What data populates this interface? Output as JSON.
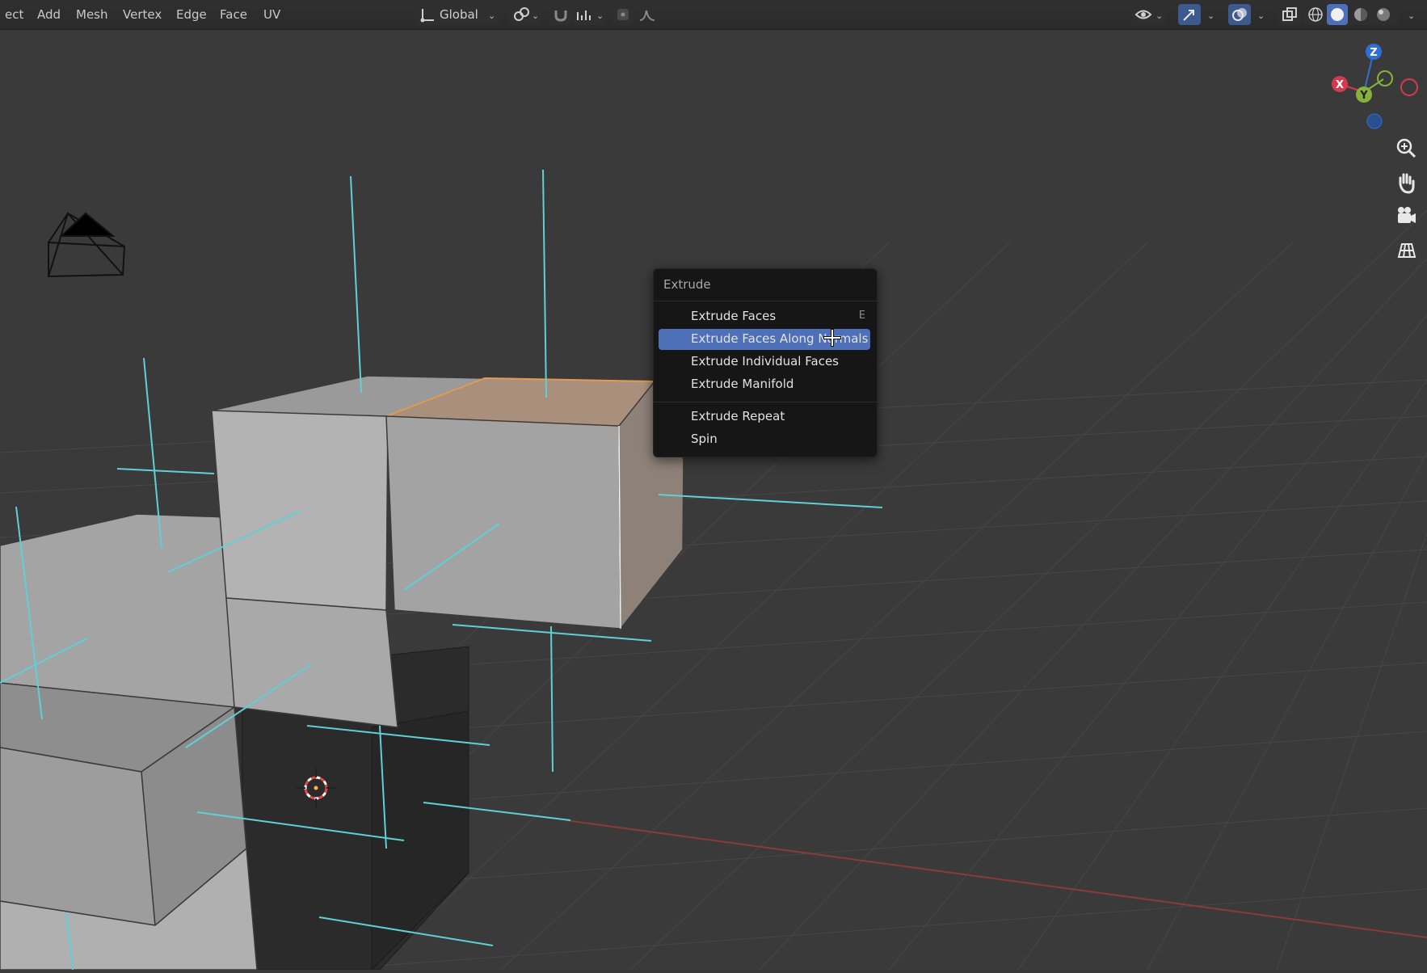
{
  "header": {
    "menus": [
      "ect",
      "Add",
      "Mesh",
      "Vertex",
      "Edge",
      "Face",
      "UV"
    ],
    "orientation": "Global"
  },
  "extrude_menu": {
    "title": "Extrude",
    "items": [
      {
        "label": "Extrude Faces",
        "shortcut": "E"
      },
      {
        "label": "Extrude Faces Along Normals",
        "shortcut": ""
      },
      {
        "label": "Extrude Individual Faces",
        "shortcut": ""
      },
      {
        "label": "Extrude Manifold",
        "shortcut": ""
      },
      {
        "label": "Extrude Repeat",
        "shortcut": ""
      },
      {
        "label": "Spin",
        "shortcut": ""
      }
    ],
    "highlighted_index": 1
  },
  "gizmo": {
    "x_label": "X",
    "y_label": "Y",
    "z_label": "Z",
    "x_color": "#d33a4d",
    "y_color": "#86b23c",
    "z_color": "#2f6fd6"
  },
  "colors": {
    "viewport_bg": "#3a3a3a",
    "grid": "#4a4a4a",
    "normals": "#5fd0d6",
    "selection": "#e39a52",
    "menu_highlight": "#4e70b8"
  }
}
